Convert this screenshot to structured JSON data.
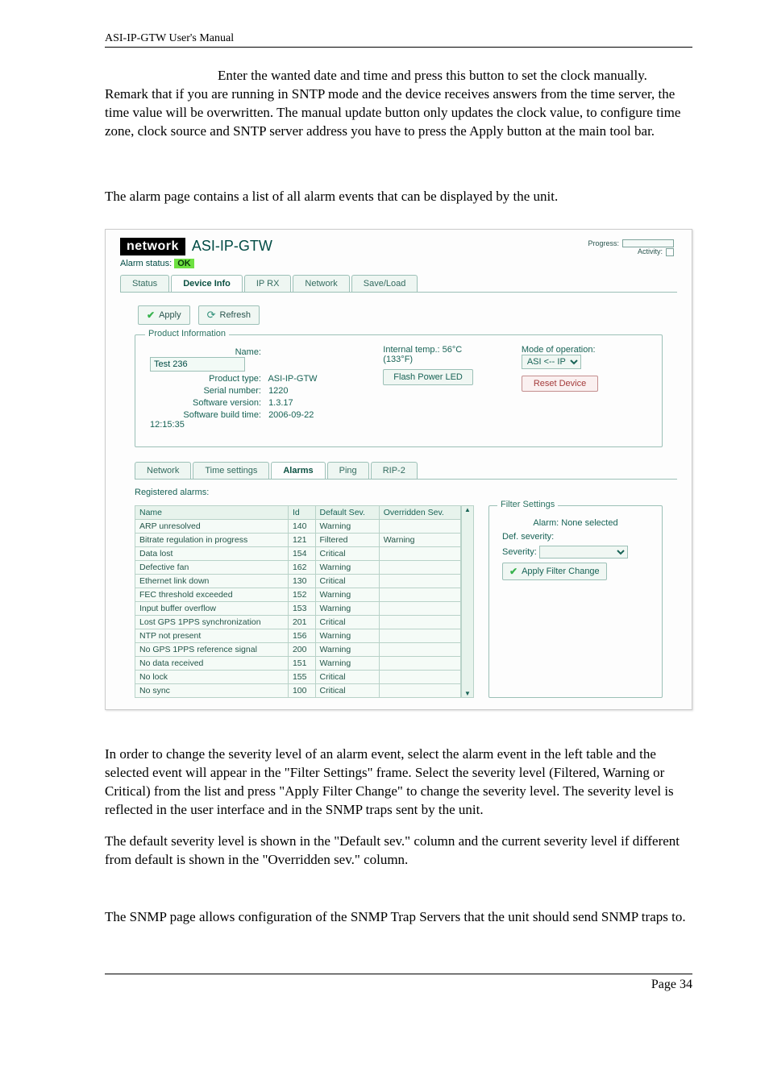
{
  "header": "ASI-IP-GTW User's Manual",
  "para1": "Enter the wanted date and time and press this button to set the clock manually. Remark that if you are running in SNTP mode and the device receives answers from the time server, the time value will be overwritten. The manual update button only updates the clock value, to configure time zone, clock source and SNTP server address you have to press the Apply button at the main tool bar.",
  "para2": "The alarm page contains a list of all alarm events that can be displayed by the unit.",
  "para3": "In order to change the severity level of an alarm event, select the alarm event in the left table and the selected event will appear in the \"Filter Settings\" frame. Select the severity level (Filtered, Warning or Critical) from the list and press \"Apply Filter Change\" to change the severity level. The severity level is reflected in the user interface and in the SNMP traps sent by the unit.",
  "para4": "The default severity level is shown in the \"Default sev.\" column and the current severity level if different from default is shown in the \"Overridden sev.\" column.",
  "para5": "The SNMP page allows configuration of the SNMP Trap Servers that the unit should send SNMP traps to.",
  "footer": "Page 34",
  "shot": {
    "logo_word": "network",
    "logo_sub": "ASI-IP-GTW",
    "progress_lbl": "Progress:",
    "activity_lbl": "Activity:",
    "alarm_status_lbl": "Alarm status:",
    "alarm_status_val": "OK",
    "main_tabs": [
      "Status",
      "Device Info",
      "IP RX",
      "Network",
      "Save/Load"
    ],
    "main_tab_sel": 1,
    "apply_btn": "Apply",
    "refresh_btn": "Refresh",
    "pi_legend": "Product Information",
    "pi": {
      "name_lbl": "Name:",
      "name_val": "Test 236",
      "ptype_lbl": "Product type:",
      "ptype_val": "ASI-IP-GTW",
      "serial_lbl": "Serial number:",
      "serial_val": "1220",
      "swver_lbl": "Software version:",
      "swver_val": "1.3.17",
      "build_lbl": "Software build time:",
      "build_val": "2006-09-22 12:15:35",
      "temp_lbl": "Internal temp.: 56°C (133°F)",
      "flash_btn": "Flash Power LED",
      "mode_lbl": "Mode of operation:",
      "mode_val": "ASI <-- IP",
      "reset_btn": "Reset Device"
    },
    "mini_tabs": [
      "Network",
      "Time settings",
      "Alarms",
      "Ping",
      "RIP-2"
    ],
    "mini_tab_sel": 2,
    "reg_title": "Registered alarms:",
    "thead": [
      "Name",
      "Id",
      "Default Sev.",
      "Overridden Sev."
    ],
    "rows": [
      {
        "n": "ARP unresolved",
        "id": "140",
        "d": "Warning",
        "o": ""
      },
      {
        "n": "Bitrate regulation in progress",
        "id": "121",
        "d": "Filtered",
        "o": "Warning"
      },
      {
        "n": "Data lost",
        "id": "154",
        "d": "Critical",
        "o": ""
      },
      {
        "n": "Defective fan",
        "id": "162",
        "d": "Warning",
        "o": ""
      },
      {
        "n": "Ethernet link down",
        "id": "130",
        "d": "Critical",
        "o": ""
      },
      {
        "n": "FEC threshold exceeded",
        "id": "152",
        "d": "Warning",
        "o": ""
      },
      {
        "n": "Input buffer overflow",
        "id": "153",
        "d": "Warning",
        "o": ""
      },
      {
        "n": "Lost GPS 1PPS synchronization",
        "id": "201",
        "d": "Critical",
        "o": ""
      },
      {
        "n": "NTP not present",
        "id": "156",
        "d": "Warning",
        "o": ""
      },
      {
        "n": "No GPS 1PPS reference signal",
        "id": "200",
        "d": "Warning",
        "o": ""
      },
      {
        "n": "No data received",
        "id": "151",
        "d": "Warning",
        "o": ""
      },
      {
        "n": "No lock",
        "id": "155",
        "d": "Critical",
        "o": ""
      },
      {
        "n": "No sync",
        "id": "100",
        "d": "Critical",
        "o": ""
      }
    ],
    "fs_legend": "Filter Settings",
    "fs_alarm_lbl": "Alarm:",
    "fs_alarm_val": "None selected",
    "fs_def_lbl": "Def. severity:",
    "fs_sev_lbl": "Severity:",
    "fs_apply": "Apply Filter Change"
  }
}
